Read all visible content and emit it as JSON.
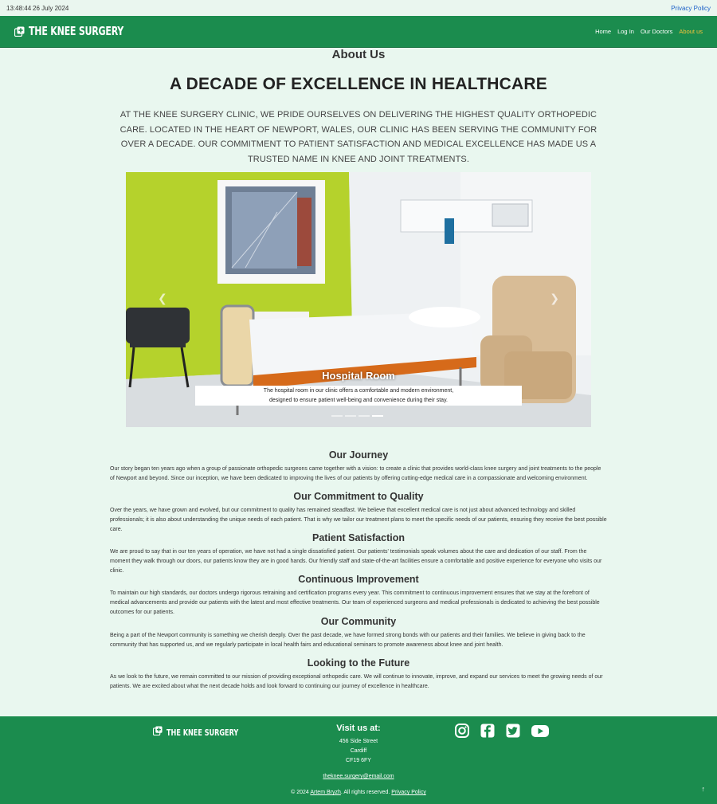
{
  "topbar": {
    "time": "13:48:44",
    "date": "26 July 2024",
    "privacy_link": "Privacy Policy"
  },
  "navbar": {
    "brand": "THE KNEE SURGERY",
    "links": [
      "Home",
      "Log In",
      "Our Doctors",
      "About us"
    ],
    "active_link": "About us"
  },
  "page": {
    "about_heading": "About Us",
    "title": "A DECADE OF EXCELLENCE IN HEALTHCARE",
    "intro": "At The Knee Surgery Clinic, we pride ourselves on delivering the highest quality orthopedic care. Located in the heart of Newport, Wales, our clinic has been serving the community for over a decade. Our commitment to patient satisfaction and medical excellence has made us a trusted name in knee and joint treatments."
  },
  "carousel": {
    "caption_title": "Hospital Room",
    "caption_line1": "The hospital room in our clinic offers a comfortable and modern environment,",
    "caption_line2": "designed to ensure patient well-being and convenience during their stay.",
    "prev_icon": "chevron-left-icon",
    "next_icon": "chevron-right-icon",
    "slide_count": 4,
    "active_slide": 4
  },
  "sections": [
    {
      "heading": "Our Journey",
      "text": "Our story began ten years ago when a group of passionate orthopedic surgeons came together with a vision: to create a clinic that provides world-class knee surgery and joint treatments to the people of Newport and beyond. Since our inception, we have been dedicated to improving the lives of our patients by offering cutting-edge medical care in a compassionate and welcoming environment."
    },
    {
      "heading": "Our Commitment to Quality",
      "text": "Over the years, we have grown and evolved, but our commitment to quality has remained steadfast. We believe that excellent medical care is not just about advanced technology and skilled professionals; it is also about understanding the unique needs of each patient. That is why we tailor our treatment plans to meet the specific needs of our patients, ensuring they receive the best possible care."
    },
    {
      "heading": "Patient Satisfaction",
      "text": "We are proud to say that in our ten years of operation, we have not had a single dissatisfied patient. Our patients' testimonials speak volumes about the care and dedication of our staff. From the moment they walk through our doors, our patients know they are in good hands. Our friendly staff and state-of-the-art facilities ensure a comfortable and positive experience for everyone who visits our clinic."
    },
    {
      "heading": "Continuous Improvement",
      "text": "To maintain our high standards, our doctors undergo rigorous retraining and certification programs every year. This commitment to continuous improvement ensures that we stay at the forefront of medical advancements and provide our patients with the latest and most effective treatments. Our team of experienced surgeons and medical professionals is dedicated to achieving the best possible outcomes for our patients."
    },
    {
      "heading": "Our Community",
      "text": "Being a part of the Newport community is something we cherish deeply. Over the past decade, we have formed strong bonds with our patients and their families. We believe in giving back to the community that has supported us, and we regularly participate in local health fairs and educational seminars to promote awareness about knee and joint health."
    },
    {
      "heading": "Looking to the Future",
      "text": "As we look to the future, we remain committed to our mission of providing exceptional orthopedic care. We will continue to innovate, improve, and expand our services to meet the growing needs of our patients. We are excited about what the next decade holds and look forward to continuing our journey of excellence in healthcare."
    }
  ],
  "footer": {
    "brand": "THE KNEE SURGERY",
    "visit_title": "Visit us at:",
    "address": [
      "456 Side Street",
      "Cardiff",
      "CF19 6FY"
    ],
    "email": "theknee.surgery@email.com",
    "copyright_prefix": "© 2024",
    "author": "Artem Bryzh",
    "rights": ". All rights reserved.",
    "privacy": "Privacy Policy",
    "social_icons": [
      "instagram-icon",
      "facebook-icon",
      "twitter-icon",
      "youtube-icon"
    ],
    "back_to_top": "↑"
  },
  "colors": {
    "brand_green": "#1b8c4e",
    "page_bg": "#e9f7ef",
    "active_link": "#f5c23b",
    "link_blue": "#1e62c9"
  }
}
